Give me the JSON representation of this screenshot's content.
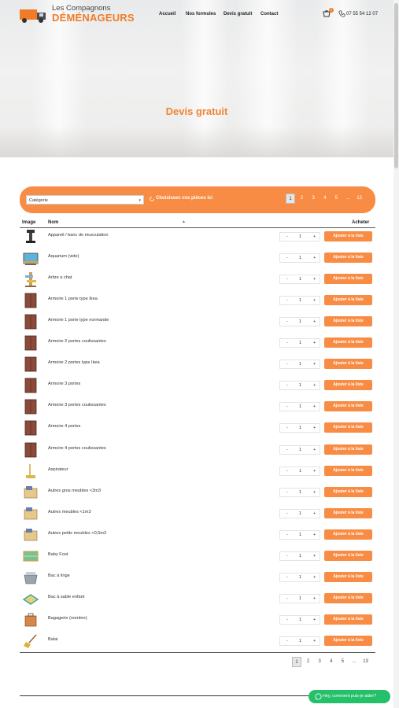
{
  "header": {
    "logo_top": "Les Compagnons",
    "logo_main": "DÉMÉNAGEURS",
    "nav": [
      "Accueil",
      "Nos formules",
      "Devis gratuit",
      "Contact"
    ],
    "cart_count": "0",
    "phone": "07 55 54 12 07"
  },
  "hero": {
    "title": "Devis gratuit"
  },
  "filters": {
    "category_label": "Catégorie",
    "pieces_link": "Choisissez vos pièces ici"
  },
  "pagination": [
    "1",
    "2",
    "3",
    "4",
    "5",
    "...",
    "13"
  ],
  "table": {
    "headers": {
      "image": "Image",
      "name": "Nom",
      "buy": "Acheter"
    },
    "quantity_default": "1",
    "minus": "-",
    "plus": "+",
    "add_label": "Ajouter à la liste",
    "rows": [
      {
        "name": "Appareil / banc de musculation",
        "icon": "weight-bench-icon"
      },
      {
        "name": "Aquarium (vide)",
        "icon": "aquarium-icon"
      },
      {
        "name": "Arbre a chat",
        "icon": "cat-tree-icon"
      },
      {
        "name": "Armoire 1 porte type Ikea",
        "icon": "wardrobe-icon"
      },
      {
        "name": "Armoire 1 porte type normande",
        "icon": "wardrobe-icon"
      },
      {
        "name": "Armoire 2 portes coulissantes",
        "icon": "wardrobe-icon"
      },
      {
        "name": "Armoire 2 portes type Ikea",
        "icon": "wardrobe-icon"
      },
      {
        "name": "Armoire 3 portes",
        "icon": "wardrobe-icon"
      },
      {
        "name": "Armoire 3 portes coulissantes",
        "icon": "wardrobe-icon"
      },
      {
        "name": "Armoire 4 portes",
        "icon": "wardrobe-icon"
      },
      {
        "name": "Armoire 4 portes coulissantes",
        "icon": "wardrobe-icon"
      },
      {
        "name": "Aspirateur",
        "icon": "vacuum-icon"
      },
      {
        "name": "Autres gros meubles <3m3",
        "icon": "furniture-icon"
      },
      {
        "name": "Autres meubles <1m3",
        "icon": "furniture-icon"
      },
      {
        "name": "Autres petits meubles <0,5m3",
        "icon": "furniture-icon"
      },
      {
        "name": "Baby Foot",
        "icon": "baby-foot-icon"
      },
      {
        "name": "Bac à linge",
        "icon": "laundry-basket-icon"
      },
      {
        "name": "Bac à sable enfant",
        "icon": "sandbox-icon"
      },
      {
        "name": "Bagagerie (nombre)",
        "icon": "luggage-icon"
      },
      {
        "name": "Balai",
        "icon": "broom-icon"
      }
    ]
  },
  "chat": {
    "label": "Hey, comment puis-je aider?"
  },
  "colors": {
    "accent": "#f98c44",
    "title": "#f08537",
    "whatsapp": "#25c06a"
  }
}
